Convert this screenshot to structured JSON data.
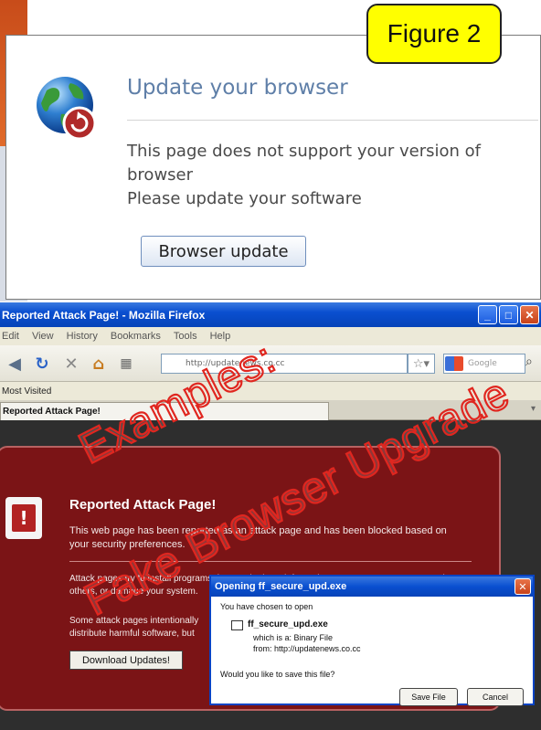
{
  "figure_label": "Figure 2",
  "update_dialog": {
    "title": "Update your browser",
    "message_line1": "This page does not support your version of",
    "message_line2": "browser",
    "message_line3": "Please update your software",
    "button_label": "Browser update"
  },
  "firefox": {
    "window_title": "Reported Attack Page! - Mozilla Firefox",
    "menu": [
      "Edit",
      "View",
      "History",
      "Bookmarks",
      "Tools",
      "Help"
    ],
    "url_value": "http://updatenews.co.cc",
    "search_placeholder": "Google",
    "bookmark_item": "Most Visited",
    "tab_label": "Reported Attack Page!"
  },
  "attack_page": {
    "title": "Reported Attack Page!",
    "text1": "This web page has been reported as an attack page and has been blocked based on your security preferences.",
    "text2": "Attack pages try to install programs that steal private information, use your computer to attack others, or damage your system.",
    "text3": "Some attack pages intentionally distribute harmful software, but many are compromised without the knowledge or permission of their owners.",
    "download_button": "Download Updates!"
  },
  "open_dialog": {
    "title": "Opening ff_secure_upd.exe",
    "chosen_text": "You have chosen to open",
    "file_name": "ff_secure_upd.exe",
    "which_is": "which is a:  Binary File",
    "from": "from:  http://updatenews.co.cc",
    "question": "Would you like to save this file?",
    "save_button": "Save File",
    "cancel_button": "Cancel"
  },
  "watermark": {
    "line1": "Examples:",
    "line2": "Fake Browser Upgrade"
  },
  "colors": {
    "figure_label_bg": "#ffff00",
    "update_title": "#5f7fa8",
    "attack_bg": "#7b1416",
    "xp_titlebar": "#0a4fd0",
    "watermark_stroke": "#e0261f"
  }
}
